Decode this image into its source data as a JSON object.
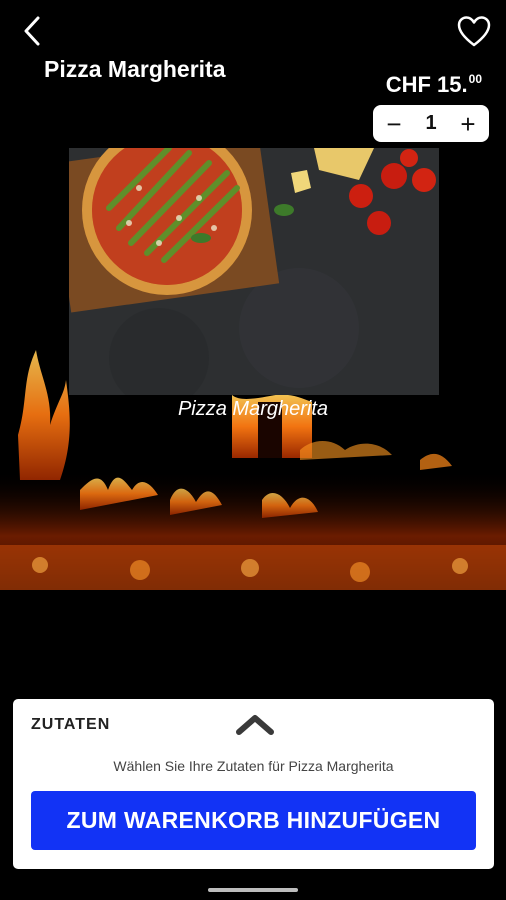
{
  "header": {
    "back_icon": "chevron-left-icon",
    "favorite_icon": "heart-outline-icon",
    "title": "Pizza Margherita"
  },
  "price": {
    "currency_main": "CHF 15.",
    "cents": "00"
  },
  "quantity": {
    "minus": "−",
    "value": "1",
    "plus": "+"
  },
  "hero": {
    "caption": "Pizza Margherita"
  },
  "sheet": {
    "title": "ZUTATEN",
    "toggle_icon": "chevron-up-icon",
    "hint": "Wählen Sie Ihre Zutaten für Pizza Margherita",
    "button_label": "ZUM WARENKORB HINZUFÜGEN"
  },
  "colors": {
    "accent": "#1233f5",
    "background": "#000000"
  }
}
